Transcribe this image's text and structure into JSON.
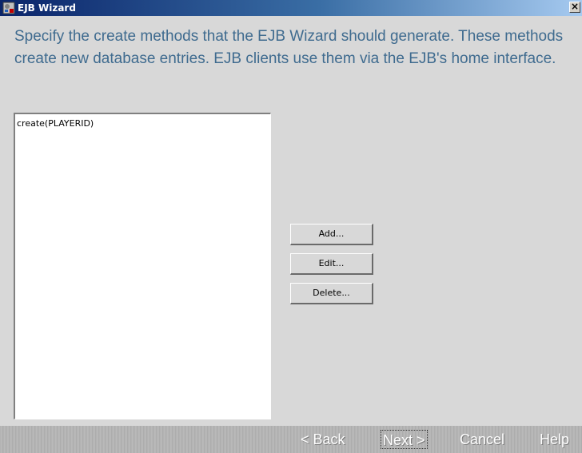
{
  "window": {
    "title": "EJB Wizard",
    "close_glyph": "×",
    "icon": "wizard-app-icon"
  },
  "instructions": "Specify the create methods that the EJB Wizard should generate. These methods create new database entries.  EJB clients use them via the EJB's home interface.",
  "methods_list": {
    "items": [
      "create(PLAYERID)"
    ]
  },
  "side_buttons": {
    "add": "Add...",
    "edit": "Edit...",
    "delete": "Delete..."
  },
  "nav": {
    "back": "< Back",
    "next": "Next >",
    "cancel": "Cancel",
    "help": "Help"
  },
  "colors": {
    "instruction_text": "#3f6b8f",
    "background": "#d8d8d8",
    "titlebar_start": "#0a246a"
  }
}
